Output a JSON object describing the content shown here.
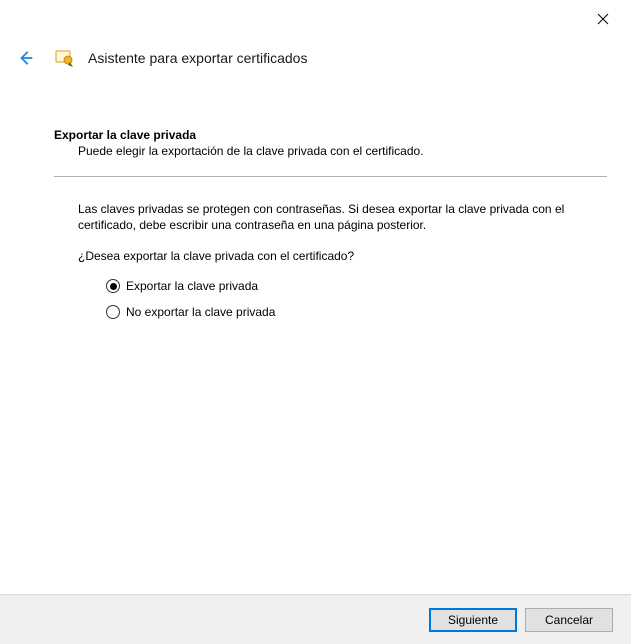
{
  "window": {
    "close_label": "Close"
  },
  "header": {
    "back_label": "Back",
    "icon_name": "certificate-wizard-icon",
    "title": "Asistente para exportar certificados"
  },
  "section": {
    "heading": "Exportar la clave privada",
    "subtext": "Puede elegir la exportación de la clave privada con el certificado."
  },
  "body": {
    "info": "Las claves privadas se protegen con contraseñas. Si desea exportar la clave privada con el certificado, debe escribir una contraseña en una página posterior.",
    "question": "¿Desea exportar la clave privada con el certificado?"
  },
  "options": {
    "selected": "export",
    "export_label": "Exportar la clave privada",
    "no_export_label": "No exportar la clave privada"
  },
  "footer": {
    "next": "Siguiente",
    "cancel": "Cancelar"
  }
}
